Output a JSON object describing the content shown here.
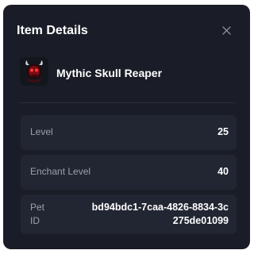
{
  "modal": {
    "title": "Item Details",
    "close_icon": "close-icon"
  },
  "item": {
    "name": "Mythic Skull Reaper",
    "icon": "skull-reaper-icon"
  },
  "fields": [
    {
      "label": "Level",
      "value": "25"
    },
    {
      "label": "Enchant Level",
      "value": "40"
    },
    {
      "label": "Pet ID",
      "value": "bd94bdc1-7caa-4826-8834-3c275de01099"
    }
  ],
  "colors": {
    "modal_bg": "#1a1d27",
    "field_bg": "#222632",
    "label_text": "#9aa0ad",
    "value_text": "#ffffff",
    "icon_accent": "#c0141c"
  }
}
